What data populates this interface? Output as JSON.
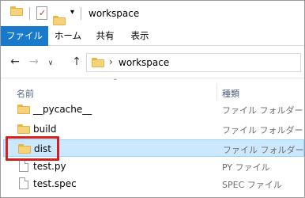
{
  "window": {
    "title": "workspace",
    "qa_dropdown_glyph": "▾",
    "props_check_glyph": "✓"
  },
  "ribbon": {
    "tabs": [
      {
        "label": "ファイル",
        "active": true
      },
      {
        "label": "ホーム"
      },
      {
        "label": "共有"
      },
      {
        "label": "表示"
      }
    ]
  },
  "nav": {
    "back_glyph": "←",
    "forward_glyph": "→",
    "recent_glyph": "∨",
    "up_glyph": "↑",
    "chevron": "›",
    "path": "workspace"
  },
  "columns": {
    "name": "名前",
    "type": "種類",
    "sort_glyph": "^"
  },
  "files": [
    {
      "name": "__pycache__",
      "type": "ファイル フォルダー",
      "icon": "folder-icon"
    },
    {
      "name": "build",
      "type": "ファイル フォルダー",
      "icon": "folder-icon"
    },
    {
      "name": "dist",
      "type": "ファイル フォルダー",
      "icon": "folder-icon",
      "selected": true
    },
    {
      "name": "test.py",
      "type": "PY ファイル",
      "icon": "file-icon"
    },
    {
      "name": "test.spec",
      "type": "SPEC ファイル",
      "icon": "file-icon"
    }
  ],
  "colors": {
    "accent": "#1979ca",
    "selection": "#cce8ff",
    "highlight": "#d21f1f",
    "folder": "#f6d37a"
  }
}
